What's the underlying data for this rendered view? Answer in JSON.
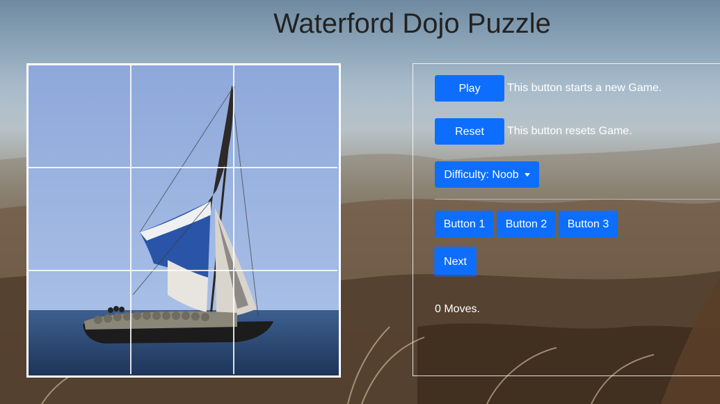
{
  "page": {
    "title": "Waterford Dojo Puzzle"
  },
  "controls": {
    "play_label": "Play",
    "play_desc": "This button starts a new Game.",
    "reset_label": "Reset",
    "reset_desc": "This button resets Game.",
    "difficulty_label": "Difficulty: Noob",
    "buttons": [
      "Button 1",
      "Button 2",
      "Button 3"
    ],
    "next_label": "Next",
    "moves_text": "0 Moves."
  },
  "puzzle": {
    "grid": "3x3",
    "image": "sailboat"
  },
  "colors": {
    "accent": "#0d6efd",
    "title": "#222222",
    "text_light": "#ffffff"
  }
}
